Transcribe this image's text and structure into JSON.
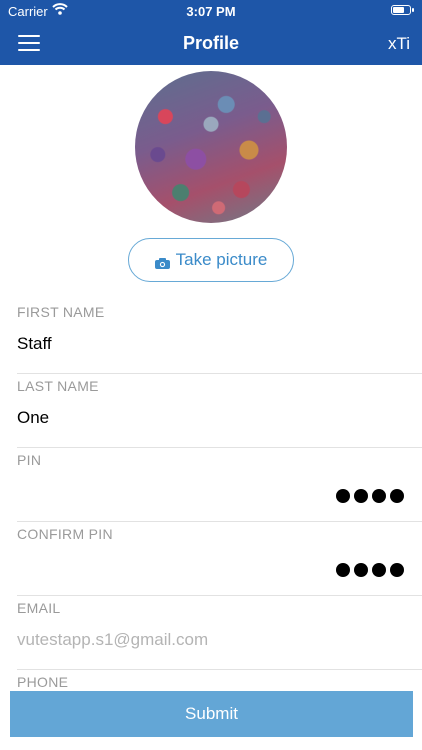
{
  "status_bar": {
    "carrier": "Carrier",
    "time": "3:07 PM",
    "battery_level": 0.55
  },
  "nav": {
    "title": "Profile",
    "right_text": "xTi",
    "menu_icon": "hamburger-icon"
  },
  "avatar": {
    "description_icon": "profile-photo"
  },
  "take_picture": {
    "label": "Take picture",
    "icon": "camera-icon"
  },
  "fields": {
    "first_name": {
      "label": "FIRST NAME",
      "value": "Staff"
    },
    "last_name": {
      "label": "LAST NAME",
      "value": "One"
    },
    "pin": {
      "label": "PIN",
      "masked_length": 4
    },
    "confirm_pin": {
      "label": "CONFIRM PIN",
      "masked_length": 4
    },
    "email": {
      "label": "EMAIL",
      "placeholder": "vutestapp.s1@gmail.com"
    },
    "phone": {
      "label": "PHONE"
    }
  },
  "submit": {
    "label": "Submit"
  },
  "colors": {
    "header": "#1e56a8",
    "accent": "#3b8bc9",
    "submit_bg": "#63a6d6"
  }
}
